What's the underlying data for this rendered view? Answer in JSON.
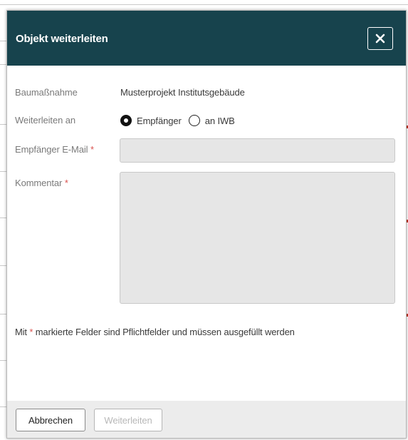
{
  "dialog": {
    "title": "Objekt weiterleiten",
    "close_icon": "close-icon"
  },
  "form": {
    "project_label": "Baumaßnahme",
    "project_value": "Musterprojekt Institutsgebäude",
    "forward_label": "Weiterleiten an",
    "radio_options": [
      {
        "label": "Empfänger",
        "checked": true
      },
      {
        "label": "an IWB",
        "checked": false
      }
    ],
    "email_label": "Empfänger E-Mail",
    "email_value": "",
    "comment_label": "Kommentar",
    "comment_value": "",
    "required_marker": "*",
    "hint_prefix": "Mit",
    "hint_suffix": "markierte Felder sind Pflichtfelder und müssen ausgefüllt werden"
  },
  "footer": {
    "cancel_label": "Abbrechen",
    "forward_label": "Weiterleiten"
  },
  "colors": {
    "header": "#17434d",
    "required": "#d9534f",
    "field_bg": "#e6e6e6",
    "footer_bg": "#ececec"
  }
}
